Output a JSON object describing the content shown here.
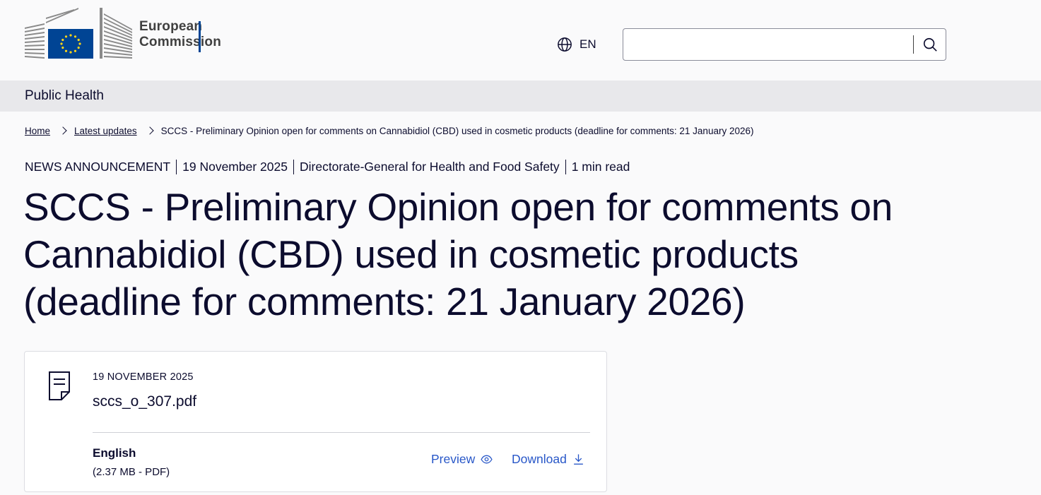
{
  "header": {
    "logo_line1": "European",
    "logo_line2": "Commission",
    "language": "EN",
    "search": {
      "value": "",
      "placeholder": ""
    }
  },
  "site": {
    "name": "Public Health"
  },
  "breadcrumb": {
    "items": [
      "Home",
      "Latest updates"
    ],
    "current": "SCCS - Preliminary Opinion open for comments on Cannabidiol (CBD) used in cosmetic products (deadline for comments: 21 January 2026)"
  },
  "meta": {
    "type": "NEWS ANNOUNCEMENT",
    "date": "19 November 2025",
    "author": "Directorate-General for Health and Food Safety",
    "read_time": "1 min read"
  },
  "page_title": "SCCS - Preliminary Opinion open for comments on Cannabidiol (CBD) used in cosmetic products (deadline for comments: 21 January 2026)",
  "file": {
    "date": "19 NOVEMBER 2025",
    "name": "sccs_o_307.pdf",
    "language": "English",
    "size": "(2.37 MB - PDF)",
    "preview_label": "Preview",
    "download_label": "Download"
  },
  "colors": {
    "text": "#0c0c2e",
    "link": "#2857c8",
    "site_bar": "#e8e8eb",
    "eu_blue": "#004494",
    "eu_yellow": "#ffd617"
  }
}
